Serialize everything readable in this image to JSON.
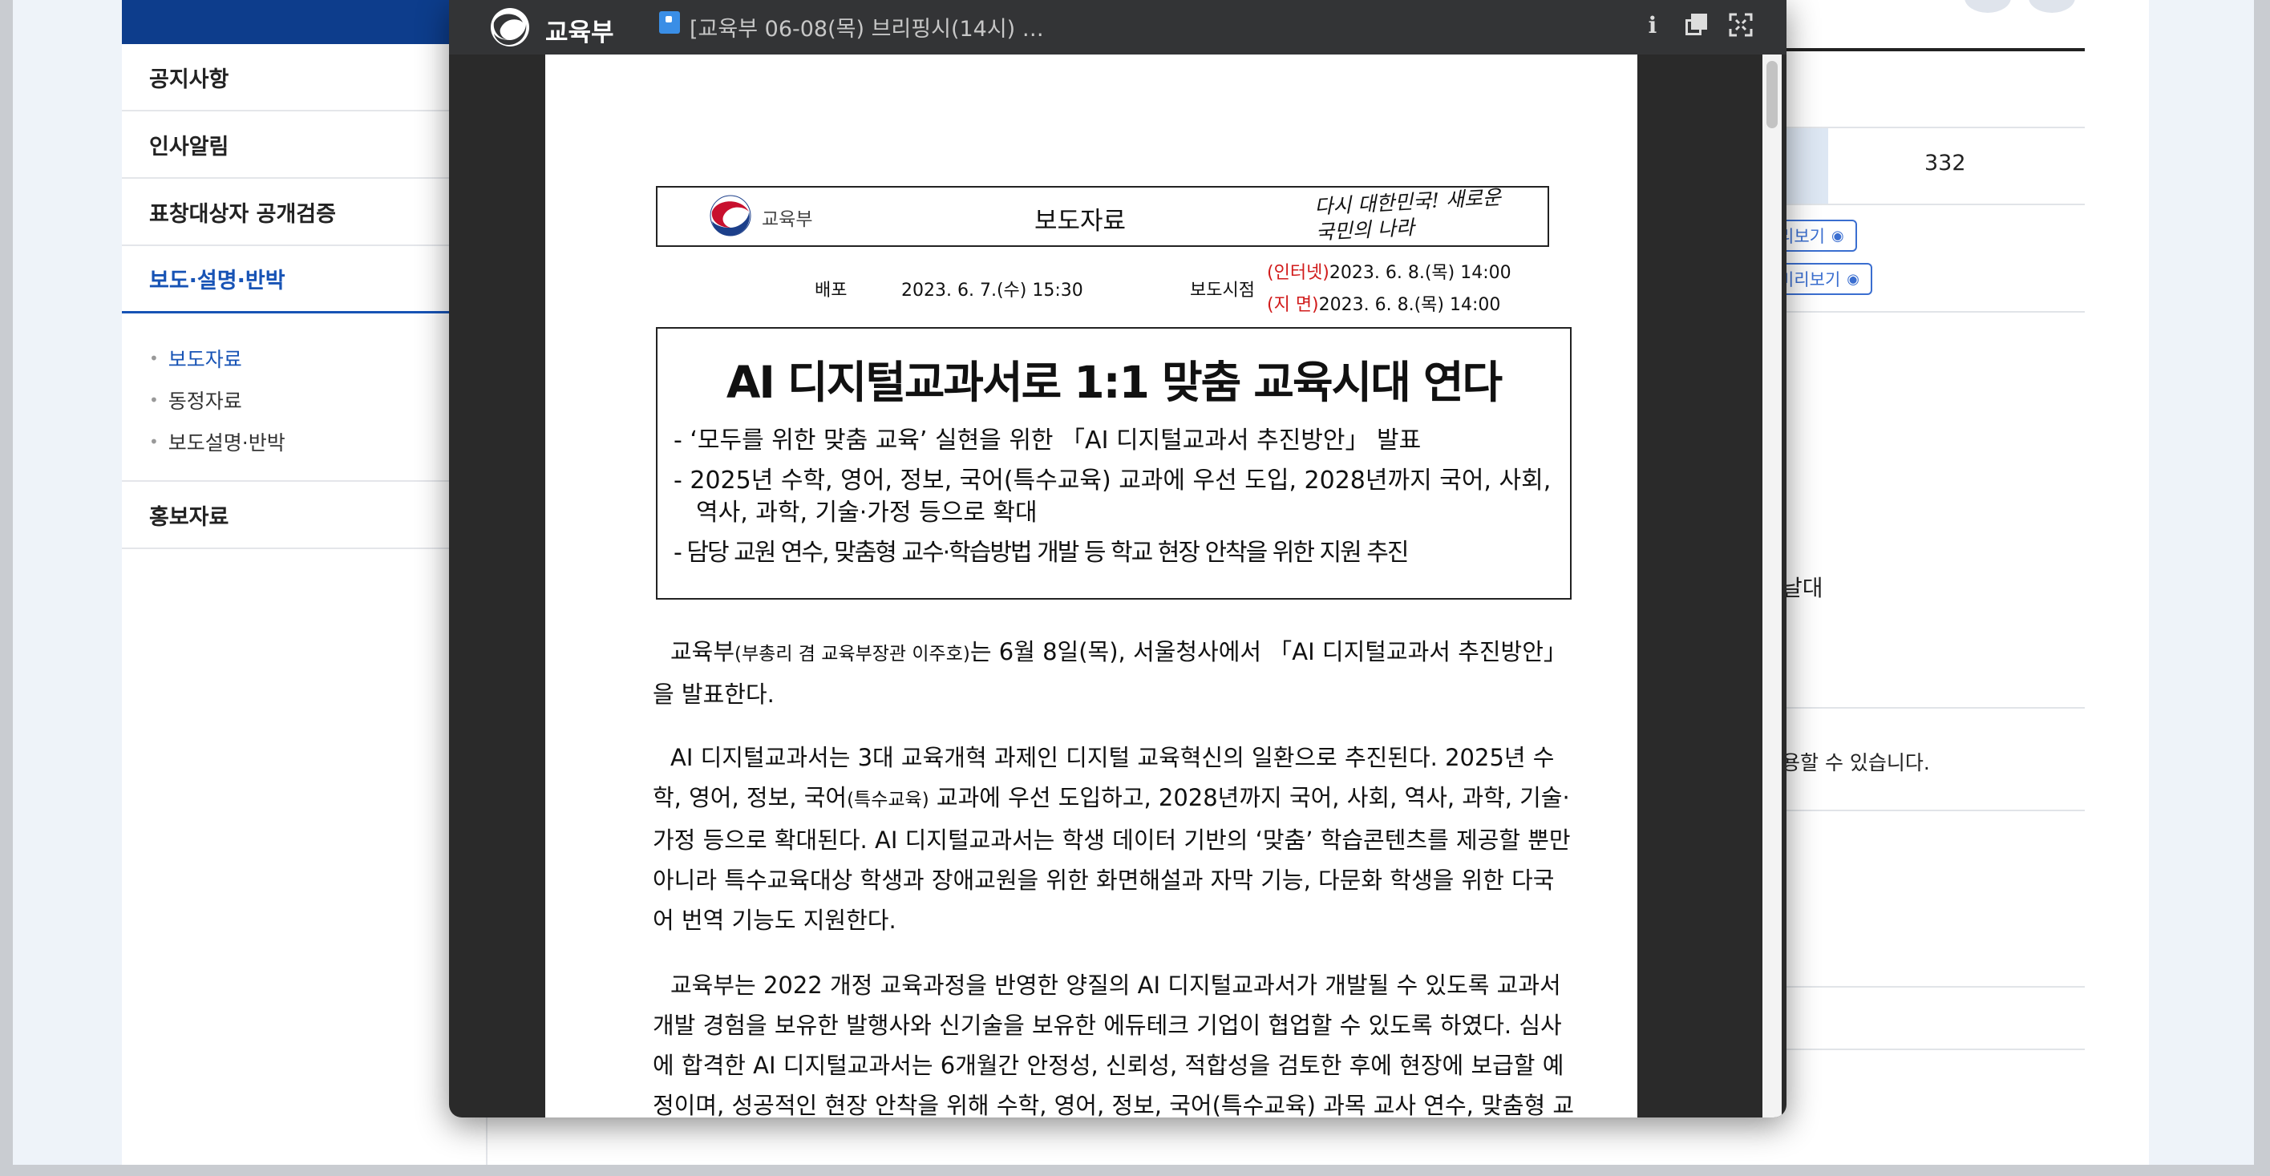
{
  "background_page": {
    "sidebar": {
      "items": [
        {
          "label": "공지사항"
        },
        {
          "label": "인사알림"
        },
        {
          "label": "표창대상자 공개검증"
        },
        {
          "label": "보도·설명·반박"
        },
        {
          "label": "홍보자료"
        }
      ],
      "subitems": [
        {
          "label": "보도자료"
        },
        {
          "label": "동정자료"
        },
        {
          "label": "보도설명·반박"
        }
      ]
    },
    "table": {
      "count_value": "332",
      "preview_label_1": "리보기",
      "preview_label_2": "미리보기"
    },
    "fragment_text_1": "날대",
    "fragment_text_2": "용할 수 있습니다."
  },
  "viewer": {
    "app_name": "교육부",
    "doc_title": "[교육부 06-08(목) 브리핑시(14시) …",
    "icons": [
      "info-icon",
      "copy-icon",
      "fullscreen-icon",
      "file-icon",
      "ministry-emblem-icon"
    ]
  },
  "document": {
    "header": {
      "ministry": "교육부",
      "type_label": "보도자료",
      "slogan": "다시 대한민국! 새로운 국민의 나라"
    },
    "meta": {
      "distribution_label": "배포",
      "distribution_date": "2023. 6. 7.(수) 15:30",
      "release_label": "보도시점",
      "internet_label": "(인터넷)",
      "internet_date": "2023. 6. 8.(목) 14:00",
      "paper_label": "(지  면)",
      "paper_date": "2023. 6. 8.(목) 14:00"
    },
    "title": "AI 디지털교과서로 1:1 맞춤 교육시대 연다",
    "bullets": [
      "- ‘모두를 위한 맞춤 교육’ 실현을 위한 「AI 디지털교과서 추진방안」 발표",
      "- 2025년 수학, 영어, 정보, 국어(특수교육) 교과에 우선 도입, 2028년까지 국어, 사회, 역사, 과학, 기술·가정 등으로 확대",
      "- 담당 교원 연수, 맞춤형 교수·학습방법 개발 등 학교 현장 안착을 위한 지원 추진"
    ],
    "para1": {
      "a": "교육부",
      "b": "(부총리 겸 교육부장관 이주호)",
      "c": "는 6월 8일(목), 서울청사에서 「AI 디지털교과서 추진방안」을 발표한다."
    },
    "para2": {
      "a": "AI 디지털교과서는 3대 교육개혁 과제인 디지털 교육혁신의 일환으로 추진된다. 2025년 수학, 영어, 정보, 국어",
      "b": "(특수교육)",
      "c": " 교과에 우선 도입하고, 2028년까지 국어, 사회, 역사, 과학, 기술·가정 등으로 확대된다. AI 디지털교과서는 학생 데이터 기반의 ‘맞춤’ 학습콘텐츠를 제공할 뿐만 아니라 특수교육대상 학생과 장애교원을 위한 화면해설과 자막 기능, 다문화 학생을 위한 다국어 번역 기능도 지원한다."
    },
    "para3": "교육부는 2022 개정 교육과정을 반영한 양질의 AI 디지털교과서가 개발될 수 있도록 교과서 개발 경험을 보유한 발행사와 신기술을 보유한 에듀테크 기업이 협업할 수 있도록 하였다. 심사에 합격한 AI 디지털교과서는 6개월간 안정성, 신뢰성, 적합성을 검토한 후에 현장에 보급할 예정이며, 성공적인 현장 안착을 위해 수학, 영어, 정보, 국어(특수교육) 과목 교사 연수, 맞춤형 교"
  },
  "colors": {
    "accent_blue": "#1753b5",
    "navy_band": "#0d3d8c",
    "meta_red": "#d11b1b",
    "viewer_bar": "#333436"
  }
}
